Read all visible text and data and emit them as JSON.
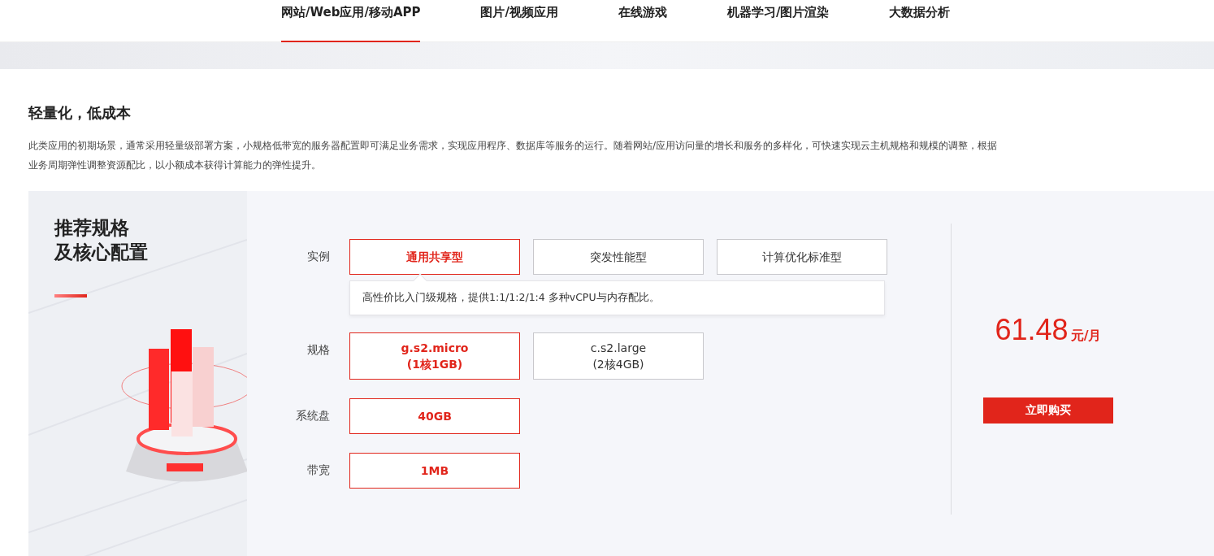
{
  "tabs": [
    {
      "label": "网站/Web应用/移动APP",
      "selected": true
    },
    {
      "label": "图片/视频应用",
      "selected": false
    },
    {
      "label": "在线游戏",
      "selected": false
    },
    {
      "label": "机器学习/图片渲染",
      "selected": false
    },
    {
      "label": "大数据分析",
      "selected": false
    }
  ],
  "intro": {
    "title": "轻量化，低成本",
    "text": "此类应用的初期场景，通常采用轻量级部署方案，小规格低带宽的服务器配置即可满足业务需求，实现应用程序、数据库等服务的运行。随着网站/应用访问量的增长和服务的多样化，可快速实现云主机规格和规模的调整，根据业务周期弹性调整资源配比，以小额成本获得计算能力的弹性提升。"
  },
  "panel": {
    "title_lines": [
      "推荐规格",
      "及核心配置"
    ],
    "rows": [
      {
        "label": "实例",
        "options": [
          {
            "lines": [
              "通用共享型"
            ],
            "selected": true
          },
          {
            "lines": [
              "突发性能型"
            ],
            "selected": false
          },
          {
            "lines": [
              "计算优化标准型"
            ],
            "selected": false
          }
        ],
        "tooltip": "高性价比入门级规格，提供1:1/1:2/1:4 多种vCPU与内存配比。"
      },
      {
        "label": "规格",
        "options": [
          {
            "lines": [
              "g.s2.micro",
              "(1核1GB)"
            ],
            "selected": true
          },
          {
            "lines": [
              "c.s2.large",
              "(2核4GB)"
            ],
            "selected": false
          }
        ]
      },
      {
        "label": "系统盘",
        "options": [
          {
            "lines": [
              "40GB"
            ],
            "selected": true
          }
        ]
      },
      {
        "label": "带宽",
        "options": [
          {
            "lines": [
              "1MB"
            ],
            "selected": true
          }
        ]
      }
    ],
    "price": "61.48",
    "unit": "元/月",
    "buy_button": "立即购买"
  }
}
